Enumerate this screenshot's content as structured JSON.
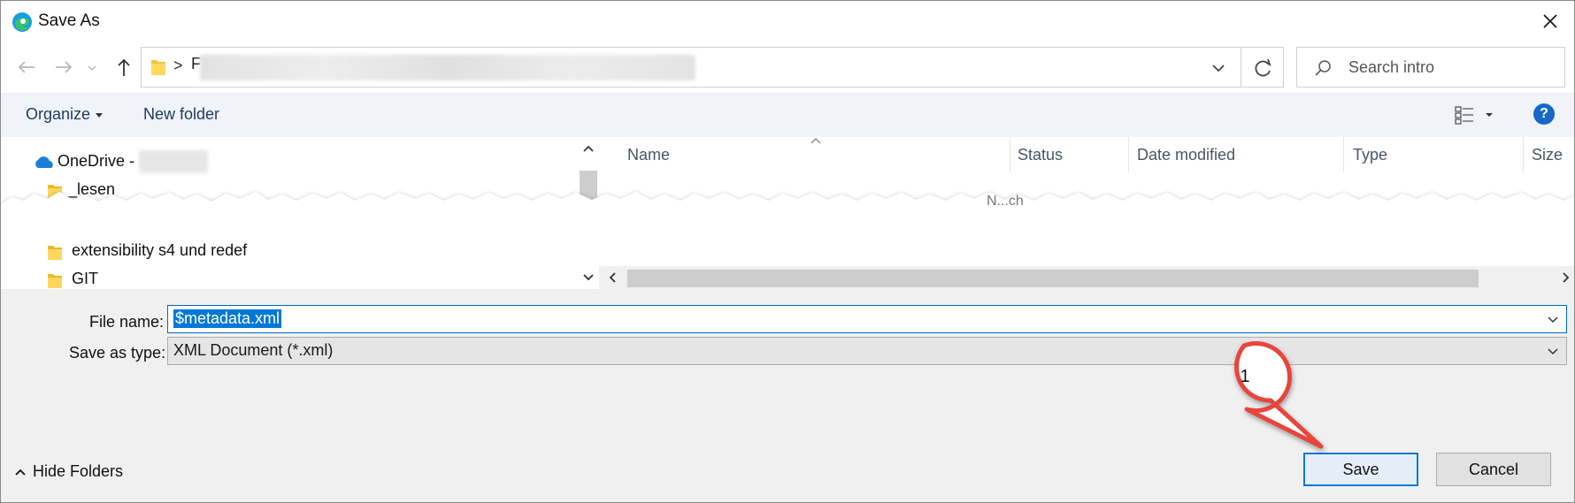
{
  "window": {
    "title": "Save As",
    "close_icon": "close-icon",
    "app_icon": "edge-icon"
  },
  "address_bar": {
    "separator": ">",
    "path_text": "F"
  },
  "search": {
    "placeholder": "Search intro"
  },
  "command_bar": {
    "organize_label": "Organize",
    "new_folder_label": "New folder",
    "help_label": "?"
  },
  "nav_pane": {
    "items": [
      {
        "label": "OneDrive - ",
        "icon": "onedrive-icon"
      },
      {
        "label": "_lesen",
        "icon": "folder-icon"
      },
      {
        "label": "extensibility s4 und redef",
        "icon": "folder-icon"
      },
      {
        "label": "GIT",
        "icon": "folder-icon"
      }
    ]
  },
  "file_list": {
    "columns": [
      "Name",
      "Status",
      "Date modified",
      "Type",
      "Size"
    ],
    "ghost_text": "N...ch"
  },
  "form": {
    "file_name_label": "File name:",
    "file_name_value": "$metadata.xml",
    "save_type_label": "Save as type:",
    "save_type_value": "XML Document (*.xml)"
  },
  "footer": {
    "hide_folders_label": "Hide Folders",
    "save_label": "Save",
    "cancel_label": "Cancel"
  },
  "annotation": {
    "callout_number": "1",
    "callout_color": "#e8453c"
  },
  "colors": {
    "accent": "#0078d7",
    "command_bar_bg": "#f0f3f8",
    "footer_bg": "#f0f0f0",
    "folder": "#f3c33c"
  }
}
